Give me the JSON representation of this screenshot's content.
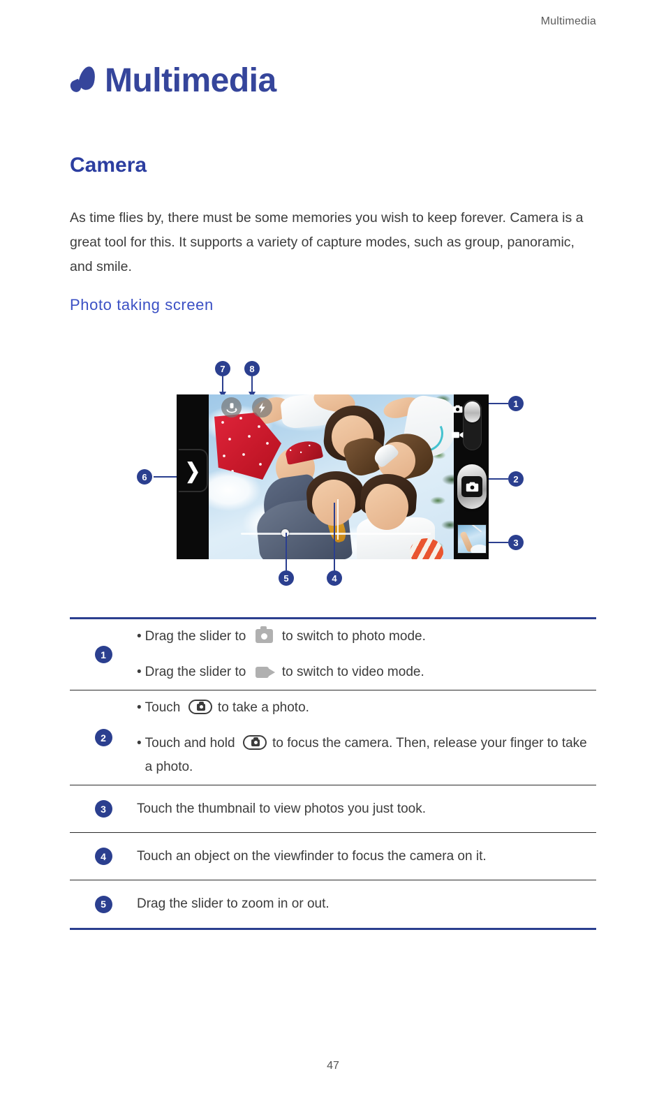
{
  "header": {
    "running_head": "Multimedia"
  },
  "chapter": {
    "title": "Multimedia",
    "mark_icon": "petal-mark-icon"
  },
  "sections": {
    "camera_heading": "Camera",
    "intro_paragraph": "As time flies by, there must be some memories you wish to keep forever. Camera is a great tool for this. It supports a variety of capture modes, such as group, panoramic, and smile.",
    "sub_heading": "Photo  taking  screen"
  },
  "figure": {
    "callouts": [
      {
        "id": "1",
        "label": "1",
        "target": "mode-switch-slider"
      },
      {
        "id": "2",
        "label": "2",
        "target": "shutter-button"
      },
      {
        "id": "3",
        "label": "3",
        "target": "gallery-thumbnail"
      },
      {
        "id": "4",
        "label": "4",
        "target": "focus-indicator"
      },
      {
        "id": "5",
        "label": "5",
        "target": "zoom-slider"
      },
      {
        "id": "6",
        "label": "6",
        "target": "settings-drawer-handle"
      },
      {
        "id": "7",
        "label": "7",
        "target": "camera-switch-icon"
      },
      {
        "id": "8",
        "label": "8",
        "target": "flash-icon"
      }
    ],
    "controls": {
      "mode_photo_icon": "camera-icon",
      "mode_video_icon": "video-camera-icon",
      "shutter_icon": "camera-icon",
      "drawer_chevron": "❯",
      "switch_camera_icon": "camera-switch-icon",
      "flash_icon": "flash-bolt-icon"
    }
  },
  "table": {
    "rows": [
      {
        "num": "1",
        "lines": [
          {
            "bullet": "•",
            "pre": "Drag the slider to",
            "icon": "camera-icon-gray",
            "post": "to switch to photo mode."
          },
          {
            "bullet": "•",
            "pre": "Drag the slider to",
            "icon": "video-camera-icon-gray",
            "post": "to switch to video mode."
          }
        ]
      },
      {
        "num": "2",
        "lines": [
          {
            "bullet": "•",
            "pre": "Touch",
            "icon": "shutter-button-icon",
            "post": "to take a photo."
          },
          {
            "bullet": "•",
            "pre": "Touch and hold",
            "icon": "shutter-button-icon",
            "post": "to focus the camera. Then, release your finger to take a photo."
          }
        ]
      },
      {
        "num": "3",
        "lines": [
          {
            "bullet": "",
            "pre": "",
            "icon": "",
            "post": "Touch the thumbnail to view photos you just took."
          }
        ]
      },
      {
        "num": "4",
        "lines": [
          {
            "bullet": "",
            "pre": "",
            "icon": "",
            "post": "Touch an object on the viewfinder to focus the camera on it."
          }
        ]
      },
      {
        "num": "5",
        "lines": [
          {
            "bullet": "",
            "pre": "",
            "icon": "",
            "post": "Drag the slider to zoom in or out."
          }
        ]
      }
    ]
  },
  "footer": {
    "page_number": "47"
  },
  "colors": {
    "brand_blue": "#2b3f8f",
    "heading_blue": "#2c3ea0",
    "subheading_blue": "#3b50c4",
    "body_text": "#3c3c3c"
  }
}
